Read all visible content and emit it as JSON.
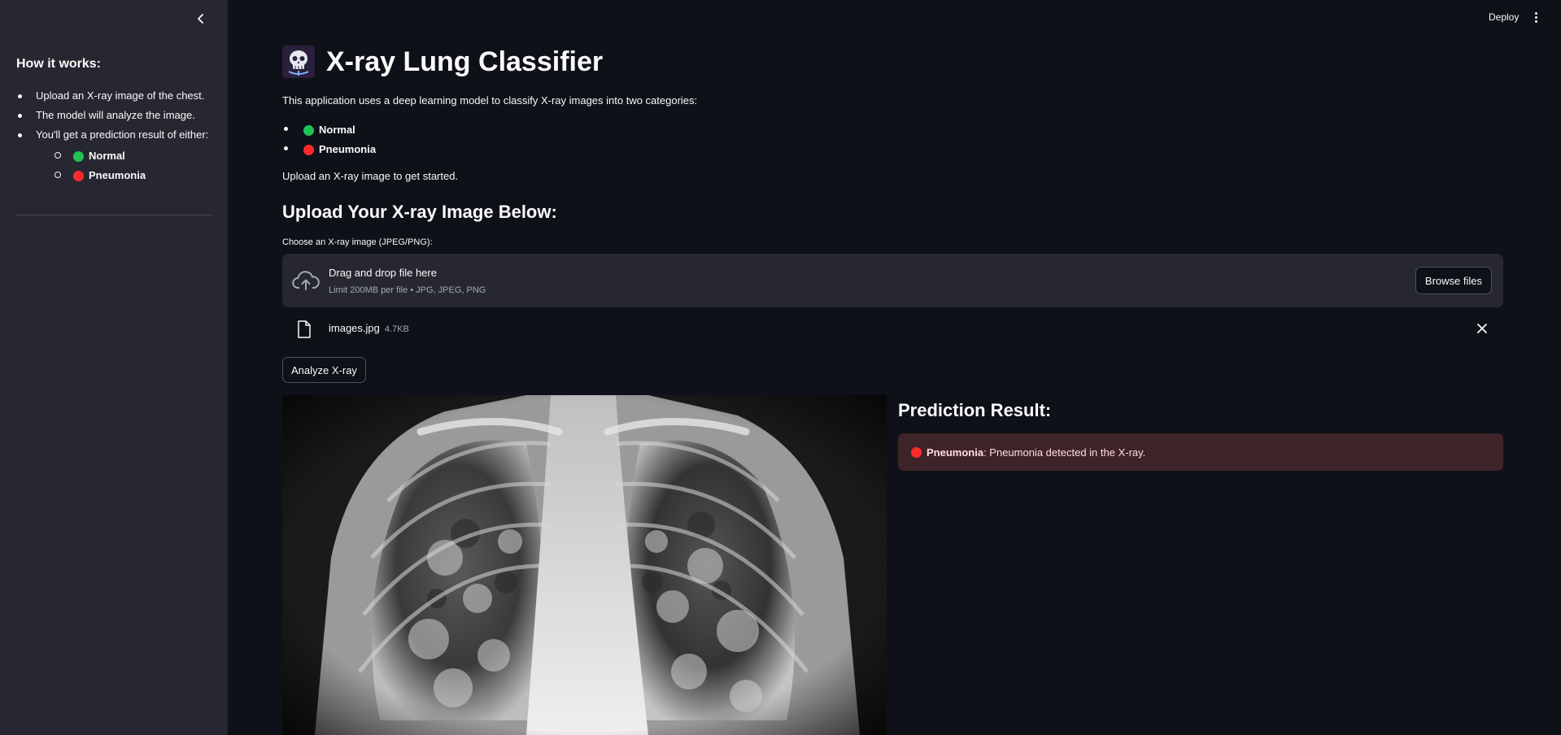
{
  "sidebar": {
    "title": "How it works:",
    "steps": [
      "Upload an X-ray image of the chest.",
      "The model will analyze the image.",
      "You'll get a prediction result of either:"
    ],
    "results": [
      {
        "label": "Normal",
        "color": "#21c354"
      },
      {
        "label": "Pneumonia",
        "color": "#ff2b2b"
      }
    ]
  },
  "header": {
    "deploy_label": "Deploy"
  },
  "main": {
    "title": "X-ray Lung Classifier",
    "intro": "This application uses a deep learning model to classify X-ray images into two categories:",
    "categories": [
      {
        "label": "Normal",
        "color": "#21c354"
      },
      {
        "label": "Pneumonia",
        "color": "#ff2b2b"
      }
    ],
    "get_started": "Upload an X-ray image to get started.",
    "upload_heading": "Upload Your X-ray Image Below:",
    "uploader": {
      "label": "Choose an X-ray image (JPEG/PNG):",
      "drag_text": "Drag and drop file here",
      "limit_text": "Limit 200MB per file • JPG, JPEG, PNG",
      "browse_label": "Browse files"
    },
    "file": {
      "name": "images.jpg",
      "size": "4.7KB"
    },
    "analyze_label": "Analyze X-ray",
    "prediction": {
      "title": "Prediction Result:",
      "label": "Pneumonia",
      "message": ": Pneumonia detected in the X-ray.",
      "color": "#ff2b2b"
    }
  }
}
